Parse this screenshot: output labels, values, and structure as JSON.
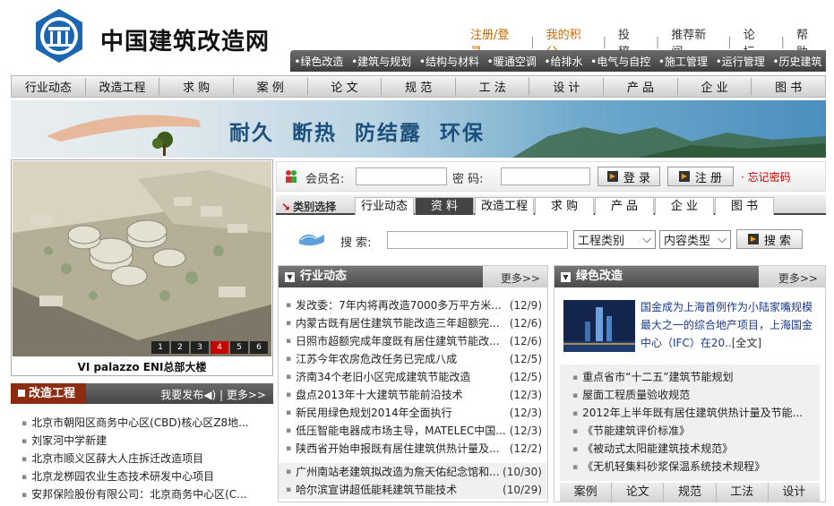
{
  "site": {
    "title": "中国建筑改造网"
  },
  "toplinks": [
    "注册/登录",
    "我的积分",
    "投 稿",
    "推荐新闻",
    "论 坛",
    "帮 助"
  ],
  "subnav": [
    "绿色改造",
    "建筑与规划",
    "结构与材料",
    "暖通空调",
    "给排水",
    "电气与自控",
    "施工管理",
    "运行管理",
    "历史建筑"
  ],
  "mainnav": [
    "行业动态",
    "改造工程",
    "求 购",
    "案 例",
    "论 文",
    "规 范",
    "工 法",
    "设 计",
    "产 品",
    "企 业",
    "图 书"
  ],
  "banner": {
    "slogan": "耐久  断热  防结露  环保"
  },
  "feature": {
    "pages": [
      "1",
      "2",
      "3",
      "4",
      "5",
      "6"
    ],
    "active_page": "4",
    "caption": "VI palazzo ENI总部大楼"
  },
  "projects": {
    "title": "改造工程",
    "publish": "我要发布◀)",
    "more": "更多>>",
    "items": [
      "北京市朝阳区商务中心区(CBD)核心区Z8地...",
      "刘家河中学新建",
      "北京市顺义区薛大人庄拆迁改造项目",
      "北京龙栁园农业生态技术研发中心项目",
      "安邦保险股份有限公司：北京商务中心区(C..."
    ]
  },
  "login": {
    "member_label": "会员名:",
    "password_label": "密 码:",
    "login_btn": "登 录",
    "register_btn": "注 册",
    "forgot": "· 忘记密码"
  },
  "category": {
    "label": "类别选择",
    "tabs": [
      "行业动态",
      "资 料",
      "改造工程",
      "求 购",
      "产 品",
      "企 业",
      "图 书"
    ],
    "active": 1
  },
  "search": {
    "label": "搜 索:",
    "select1": "工程类别",
    "select2": "内容类型",
    "btn": "搜 索"
  },
  "industry": {
    "title": "行业动态",
    "more": "更多>>",
    "items": [
      {
        "t": "发改委：7年内将再改造7000多万平方米...",
        "d": "(12/9)"
      },
      {
        "t": "内蒙古既有居住建筑节能改造三年超额完...",
        "d": "(12/6)"
      },
      {
        "t": "日照市超额完成年度既有居住建筑节能改...",
        "d": "(12/6)"
      },
      {
        "t": "江苏今年农房危改任务已完成八成",
        "d": "(12/5)"
      },
      {
        "t": "济南34个老旧小区完成建筑节能改造",
        "d": "(12/5)"
      },
      {
        "t": "盘点2013年十大建筑节能前沿技术",
        "d": "(12/3)"
      },
      {
        "t": "新民用绿色规划2014年全面执行",
        "d": "(12/3)"
      },
      {
        "t": "低压智能电器成市场主导，MATELEC中国...",
        "d": "(12/3)"
      },
      {
        "t": "陕西省开始申报既有居住建筑供热计量及...",
        "d": "(12/2)"
      },
      {
        "t": "广州南站老建筑拟改造为詹天佑纪念馆和...",
        "d": "(10/30)"
      },
      {
        "t": "哈尔滨宣讲超低能耗建筑节能技术",
        "d": "(10/29)"
      }
    ]
  },
  "green": {
    "title": "绿色改造",
    "more": "更多>>",
    "headline": "国金成为上海首例作为小陆家嘴规模最大之一的综合地产项目，上海国金中心（IFC）在20..",
    "fulltext": "[全文]",
    "items": [
      "重点省市“十二五”建筑节能规划",
      "屋面工程质量验收规范",
      "2012年上半年既有居住建筑供热计量及节能...",
      "《节能建筑评价标准》",
      "《被动式太阳能建筑技术规范》",
      "《无机轻集料砂浆保温系统技术规程》"
    ],
    "bottom_tabs": [
      "案例",
      "论文",
      "规范",
      "工法",
      "设计"
    ]
  }
}
